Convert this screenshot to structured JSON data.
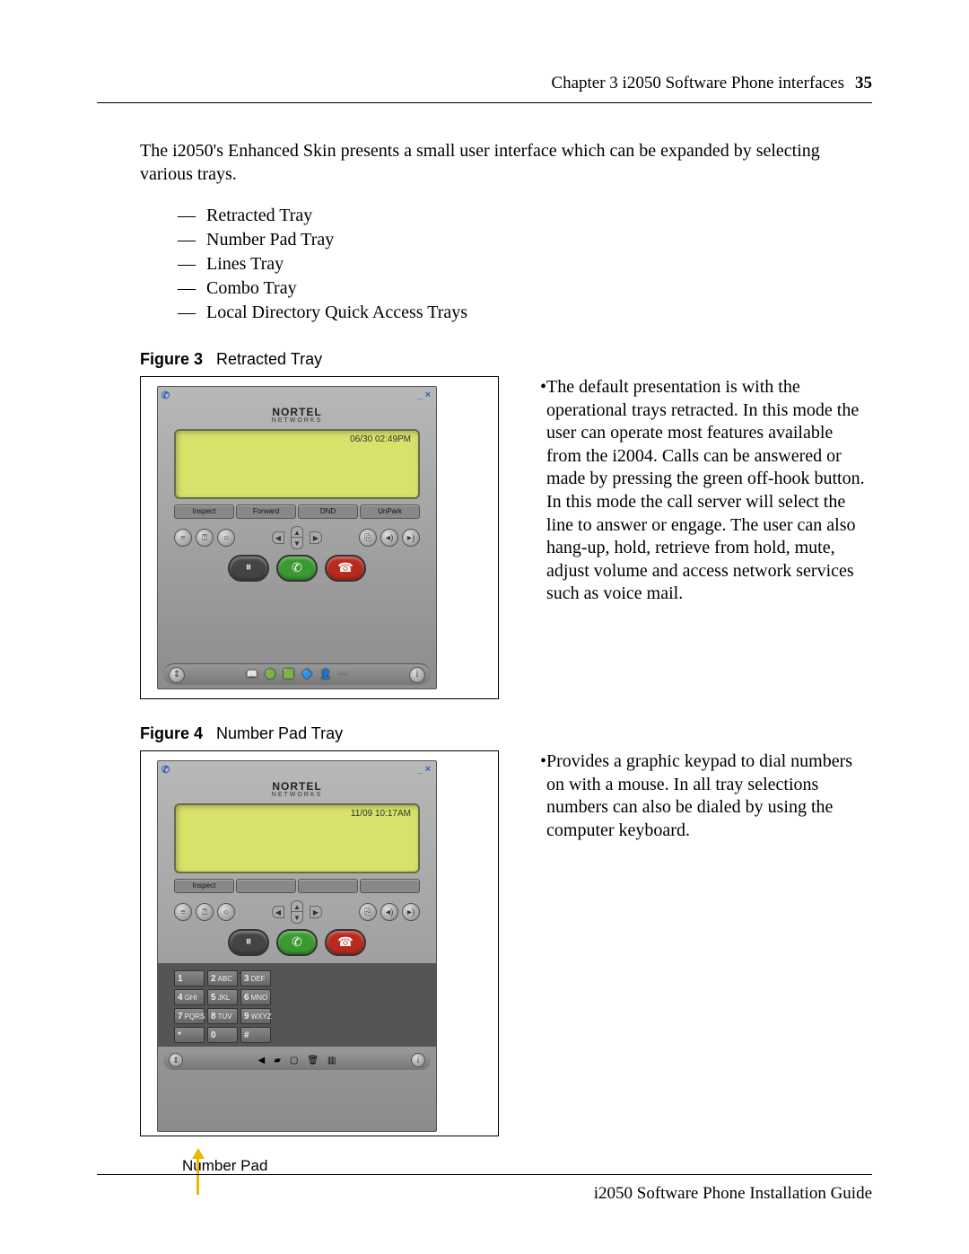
{
  "header": {
    "chapter": "Chapter 3  i2050 Software Phone interfaces",
    "page_number": "35"
  },
  "intro": "The i2050's Enhanced Skin presents a small user interface which can be expanded by selecting various trays.",
  "tray_list": [
    "Retracted Tray",
    "Number Pad Tray",
    "Lines Tray",
    "Combo Tray",
    "Local Directory Quick Access Trays"
  ],
  "figure3": {
    "caption_label": "Figure 3",
    "caption_text": "Retracted Tray",
    "phone": {
      "titlebar_min": "_",
      "titlebar_close": "×",
      "brand_top": "NORTEL",
      "brand_bottom": "NETWORKS",
      "lcd_time": "06/30  02:49PM",
      "softkeys": [
        "Inspect",
        "Forward",
        "DND",
        "UnPark"
      ]
    },
    "desc": "The default presentation is with the operational trays retracted. In this mode the user can operate most features available from the i2004. Calls can be answered or made by pressing the green off-hook button. In this mode the call server will select the line to answer or engage. The user can also hang-up, hold, retrieve from hold, mute, adjust volume and access network services such as voice mail."
  },
  "figure4": {
    "caption_label": "Figure 4",
    "caption_text": "Number Pad Tray",
    "phone": {
      "brand_top": "NORTEL",
      "brand_bottom": "NETWORKS",
      "lcd_time": "11/09  10:17AM",
      "softkeys": [
        "Inspect",
        "",
        "",
        ""
      ],
      "keypad": [
        {
          "d": "1",
          "l": ""
        },
        {
          "d": "2",
          "l": "ABC"
        },
        {
          "d": "3",
          "l": "DEF"
        },
        {
          "d": "4",
          "l": "GHI"
        },
        {
          "d": "5",
          "l": "JKL"
        },
        {
          "d": "6",
          "l": "MNO"
        },
        {
          "d": "7",
          "l": "PQRS"
        },
        {
          "d": "8",
          "l": "TUV"
        },
        {
          "d": "9",
          "l": "WXYZ"
        },
        {
          "d": "*",
          "l": ""
        },
        {
          "d": "0",
          "l": ""
        },
        {
          "d": "#",
          "l": ""
        }
      ]
    },
    "callout": "Number Pad",
    "desc": "Provides a graphic keypad to dial numbers on with a mouse. In all tray selections numbers can also be dialed by using the computer keyboard."
  },
  "footer": "i2050 Software Phone Installation Guide"
}
